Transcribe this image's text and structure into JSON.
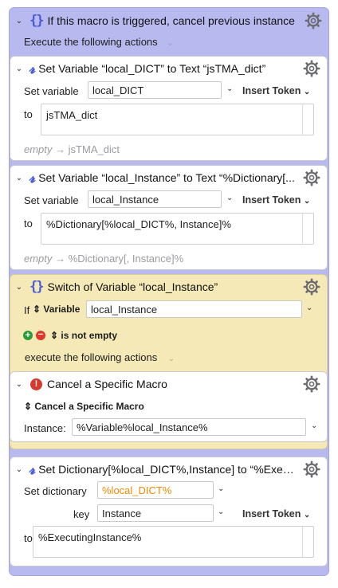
{
  "macro": {
    "title": "If this macro is triggered, cancel previous instance",
    "execute_label": "Execute the following actions"
  },
  "action1": {
    "title": "Set Variable “local_DICT” to Text “jsTMA_dict”",
    "set_variable_label": "Set variable",
    "variable": "local_DICT",
    "insert_token": "Insert Token",
    "to_label": "to",
    "text": "jsTMA_dict",
    "preview_prefix": "empty",
    "preview_value": "jsTMA_dict"
  },
  "action2": {
    "title": "Set Variable “local_Instance” to Text “%Dictionary[...",
    "set_variable_label": "Set variable",
    "variable": "local_Instance",
    "insert_token": "Insert Token",
    "to_label": "to",
    "text": "%Dictionary[%local_DICT%, Instance]%",
    "preview_prefix": "empty",
    "preview_value": "%Dictionary[, Instance]%"
  },
  "action3": {
    "title": "Switch of Variable “local_Instance”",
    "if_label": "If",
    "variable_label": "Variable",
    "variable": "local_Instance",
    "condition": "is not empty",
    "execute_label": "execute the following actions"
  },
  "action4": {
    "title": "Cancel a Specific Macro",
    "mode": "Cancel a Specific Macro",
    "instance_label": "Instance:",
    "instance_value": "%Variable%local_Instance%"
  },
  "action5": {
    "title": "Set Dictionary[%local_DICT%,Instance] to “%Execu...",
    "dict_label": "Set dictionary",
    "dict_value": "%local_DICT%",
    "key_label": "key",
    "key_value": "Instance",
    "insert_token": "Insert Token",
    "to_label": "to:",
    "to_value": "%ExecutingInstance%"
  },
  "colors": {
    "group_bg": "#b8b9ef",
    "switch_bg": "#f4e9b7",
    "icon_blue": "#4a5bd8",
    "dict_orange": "#f08a00",
    "cancel_red": "#d63a2e"
  }
}
